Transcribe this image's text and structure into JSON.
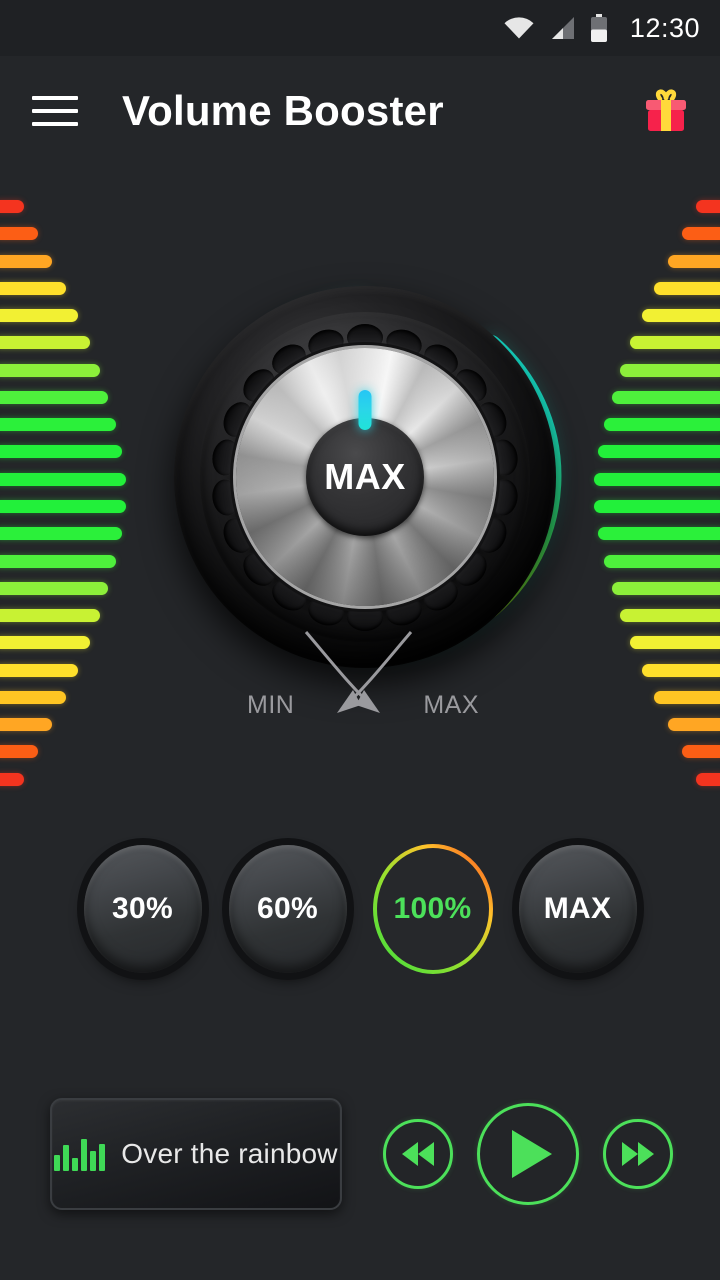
{
  "statusbar": {
    "time": "12:30",
    "icons": [
      "wifi-icon",
      "cellular-signal-icon",
      "battery-icon"
    ],
    "battery_level_pct": 50,
    "signal_bars": 2
  },
  "appbar": {
    "menu_icon": "hamburger-menu-icon",
    "title": "Volume Booster",
    "gift_icon": "gift-icon"
  },
  "colors": {
    "background": "#242629",
    "accent_green": "#4ce05a",
    "pointer_cyan": "#2ad6e8",
    "arc_start": "#1ee6e0",
    "arc_mid": "#3ddc3d",
    "arc_end": "#ffb400",
    "meter_red": "#f4341f",
    "meter_orange": "#ff7a1c",
    "meter_yellow": "#ffe92b",
    "meter_green": "#2bf03a",
    "text_muted": "#9a9a9e"
  },
  "knob": {
    "center_label": "MAX",
    "min_label": "MIN",
    "max_label": "MAX",
    "pointer_icon": "knob-pointer-indicator",
    "value_pct": 100,
    "arc_sweep_deg": 265
  },
  "presets": [
    {
      "label": "30%",
      "active": false
    },
    {
      "label": "60%",
      "active": false
    },
    {
      "label": "100%",
      "active": true
    },
    {
      "label": "MAX",
      "active": false
    }
  ],
  "player": {
    "eq_icon": "equalizer-bars-icon",
    "track_title": "Over the rainbow",
    "prev_icon": "rewind-icon",
    "play_icon": "play-icon",
    "next_icon": "fast-forward-icon"
  },
  "meters": {
    "bar_count": 22,
    "left": {
      "lengths": [
        30,
        44,
        58,
        72,
        84,
        96,
        106,
        114,
        122,
        128,
        132,
        132,
        128,
        122,
        114,
        106,
        96,
        84,
        72,
        58,
        44,
        30
      ],
      "colors": [
        "#f4341f",
        "#fc5e15",
        "#ffa623",
        "#ffe02b",
        "#f2f033",
        "#c8f233",
        "#8cf03a",
        "#4ef03c",
        "#2bf03a",
        "#22f03a",
        "#22f03a",
        "#22f03a",
        "#2bf03a",
        "#4ef03c",
        "#8cf03a",
        "#c8f233",
        "#f2f033",
        "#ffe02b",
        "#ffc523",
        "#ffa623",
        "#fc5e15",
        "#f4341f"
      ]
    },
    "right": {
      "lengths": [
        30,
        44,
        58,
        72,
        84,
        96,
        106,
        114,
        122,
        128,
        132,
        132,
        128,
        122,
        114,
        106,
        96,
        84,
        72,
        58,
        44,
        30
      ],
      "colors": [
        "#f4341f",
        "#fc5e15",
        "#ffa623",
        "#ffe02b",
        "#f2f033",
        "#c8f233",
        "#8cf03a",
        "#4ef03c",
        "#2bf03a",
        "#22f03a",
        "#22f03a",
        "#22f03a",
        "#2bf03a",
        "#4ef03c",
        "#8cf03a",
        "#c8f233",
        "#f2f033",
        "#ffe02b",
        "#ffc523",
        "#ffa623",
        "#fc5e15",
        "#f4341f"
      ]
    }
  }
}
